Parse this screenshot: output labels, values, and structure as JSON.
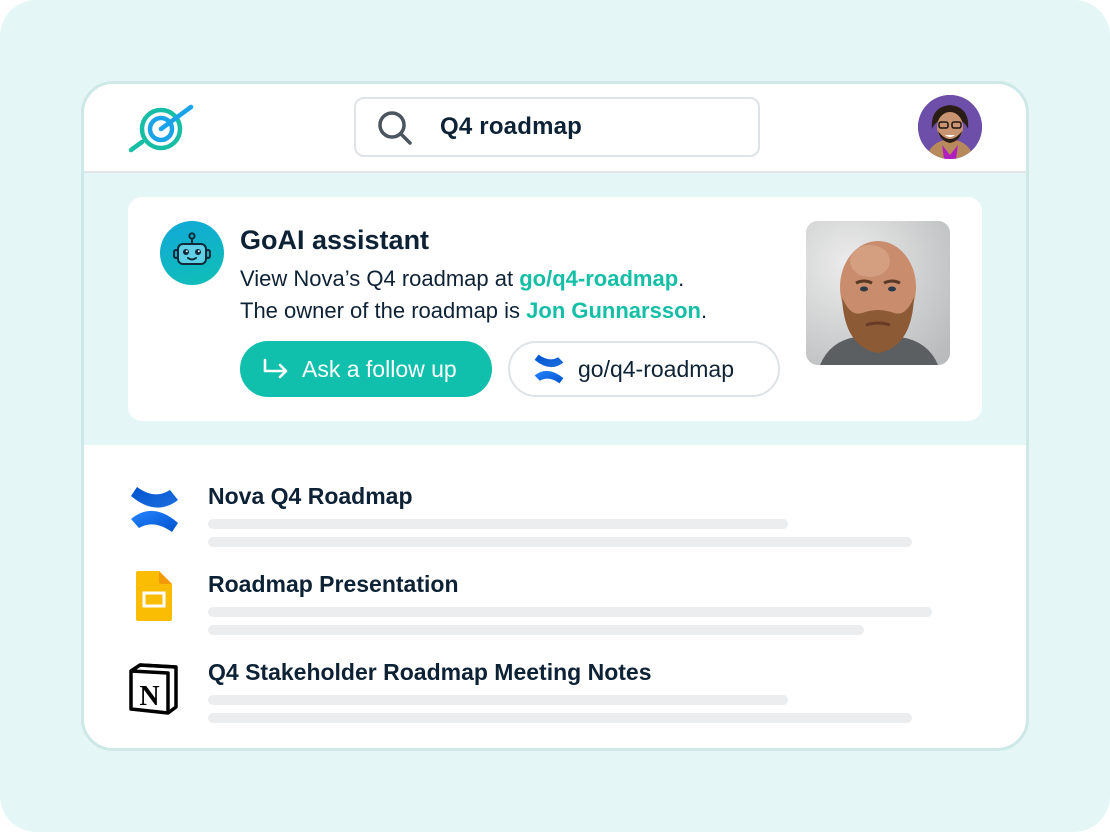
{
  "app": {
    "logo_icon": "goai-search-logo-icon",
    "colors": {
      "accent": "#10bfac",
      "link": "#14bfa6",
      "text": "#0e2235",
      "background": "#e4f6f6",
      "border": "#cde8e6",
      "placeholder_line": "#ecedef"
    }
  },
  "search": {
    "icon": "search-icon",
    "query": "Q4 roadmap"
  },
  "user": {
    "avatar_icon": "user-avatar"
  },
  "assistant": {
    "icon": "robot-icon",
    "title": "GoAI assistant",
    "line1_prefix": "View Nova’s Q4 roadmap at ",
    "line1_link": "go/q4-roadmap",
    "line1_suffix": ".",
    "line2_prefix": "The owner of the roadmap is ",
    "line2_link": "Jon Gunnarsson",
    "line2_suffix": ".",
    "followup_button": {
      "icon": "reply-arrow-icon",
      "label": "Ask a follow up"
    },
    "golink_button": {
      "icon": "confluence-icon",
      "label": "go/q4-roadmap"
    },
    "owner_photo": "owner-photo"
  },
  "results": [
    {
      "icon": "confluence-icon",
      "title": "Nova Q4 Roadmap"
    },
    {
      "icon": "google-slides-icon",
      "title": "Roadmap Presentation"
    },
    {
      "icon": "notion-icon",
      "title": "Q4 Stakeholder Roadmap Meeting Notes"
    }
  ]
}
